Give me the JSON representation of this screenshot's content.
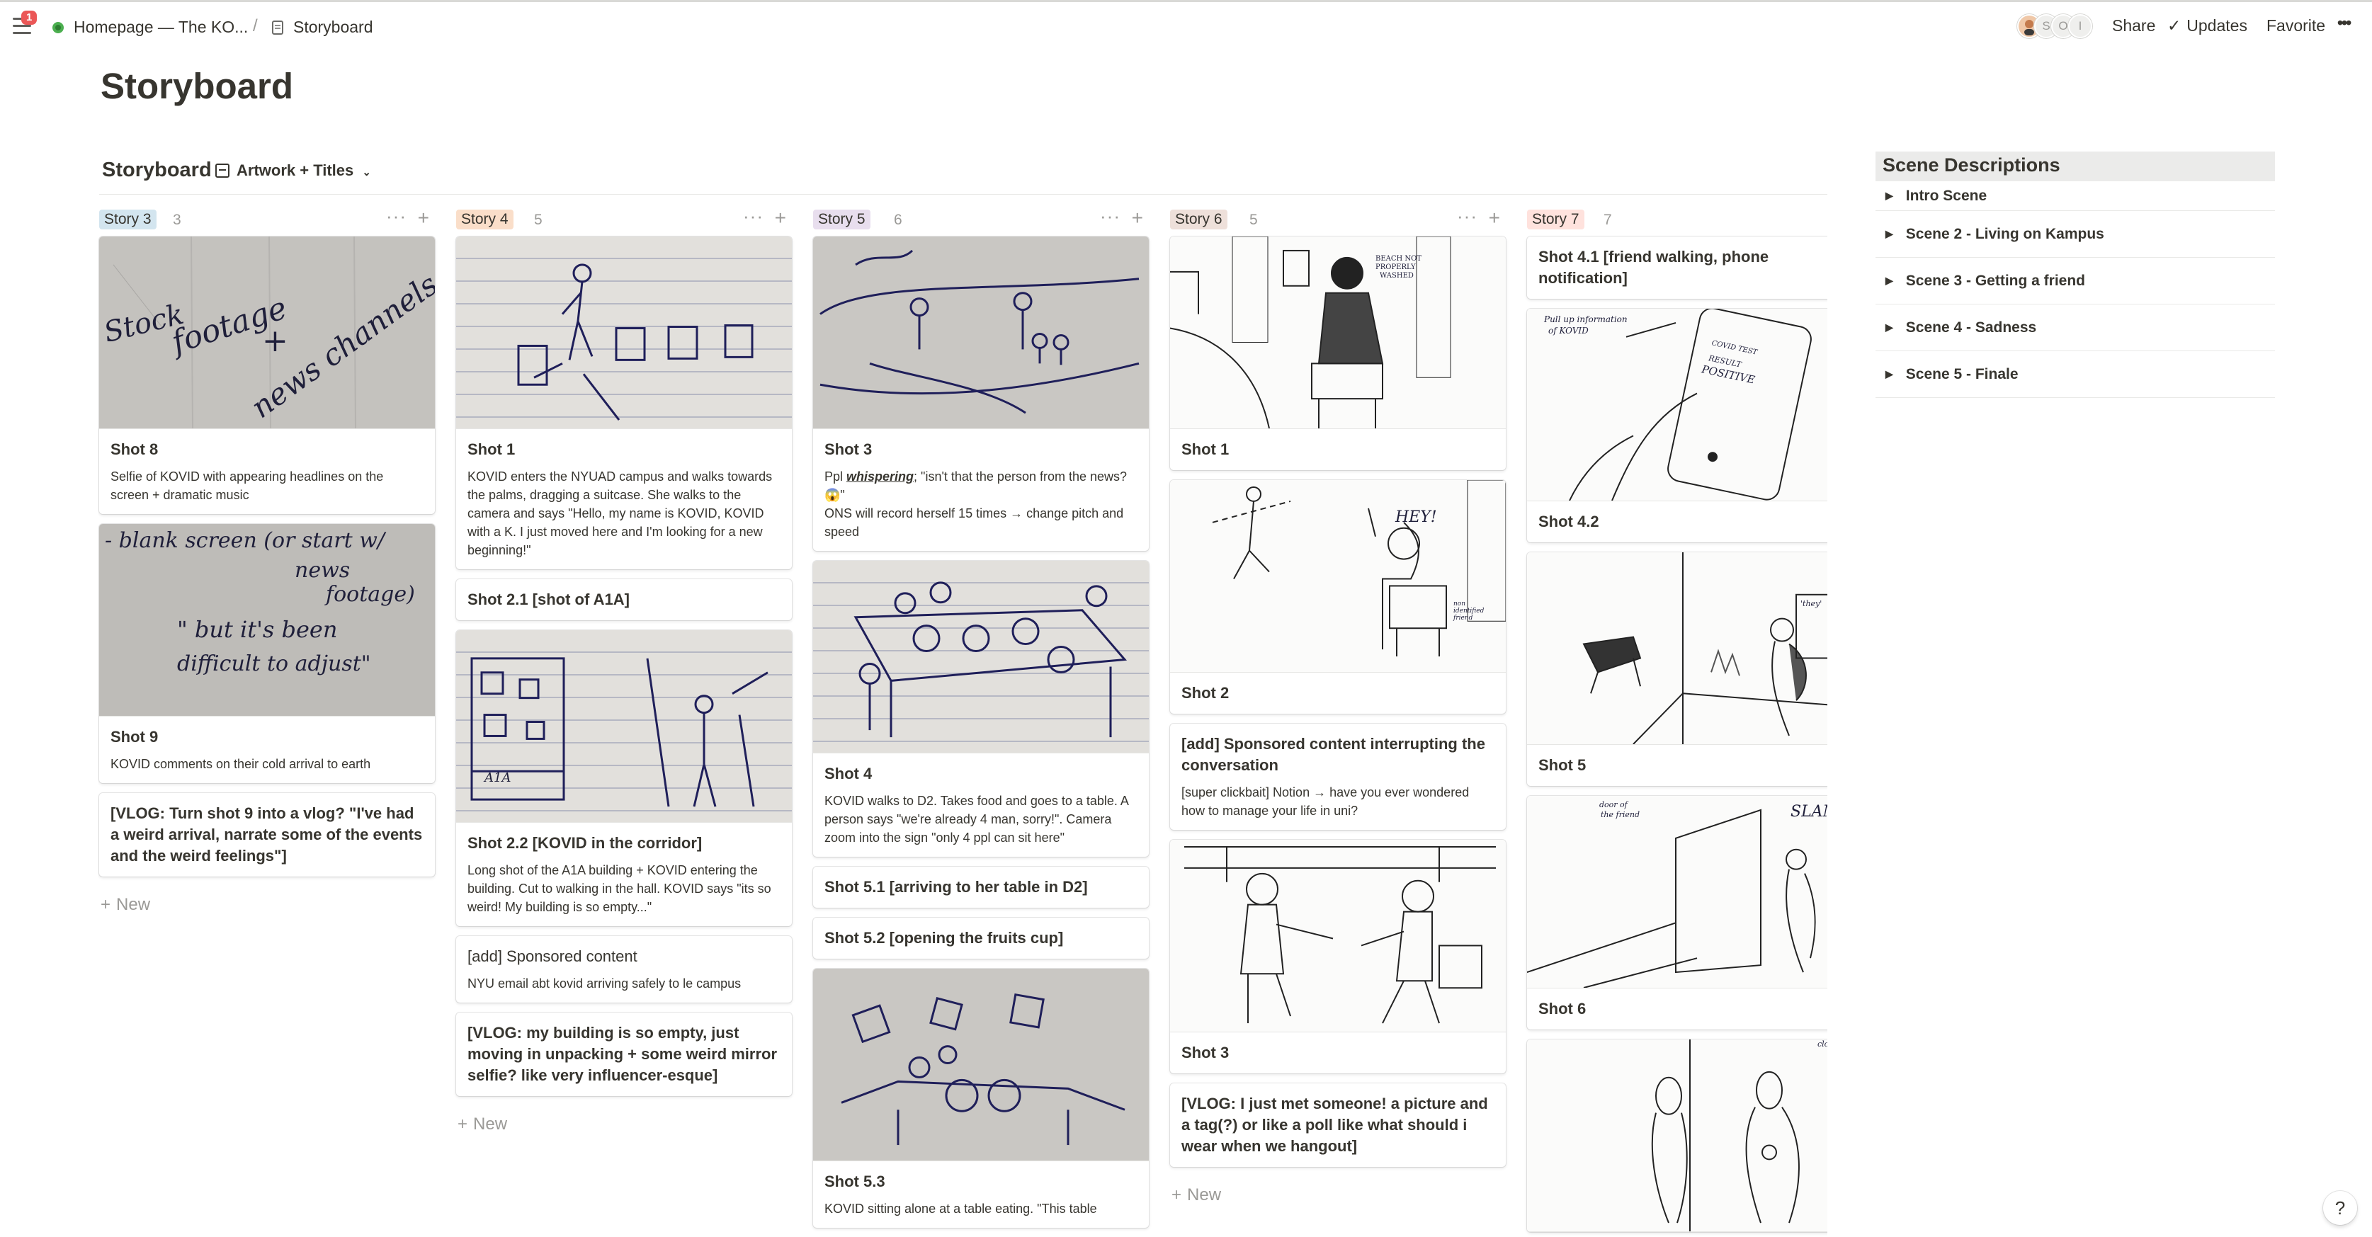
{
  "topbar": {
    "notification_count": "1",
    "breadcrumb": [
      "Homepage — The KO...",
      "/",
      "Storyboard"
    ],
    "share_label": "Share",
    "updates_label": "Updates",
    "favorite_label": "Favorite",
    "more_label": "•••",
    "avatars": [
      "S",
      "O",
      "I"
    ]
  },
  "page": {
    "title": "Storyboard"
  },
  "view": {
    "name": "Storyboard",
    "layout_label": "Artwork + Titles"
  },
  "board": {
    "columns": [
      {
        "label": "Story 3",
        "count": "3",
        "color": "#d3e5ef",
        "cards": [
          {
            "title": "Shot 8",
            "desc": "Selfie of KOVID with appearing headlines on the screen + dramatic music",
            "image_text": [
              "Stock",
              "footage",
              "+",
              "news channels"
            ]
          },
          {
            "title": "Shot 9",
            "desc": "KOVID comments on their cold arrival to earth",
            "image_text": [
              "- blank screen (or start w/",
              "news",
              "footage)",
              "\" but it's been",
              "difficult to adjust\""
            ]
          },
          {
            "title": "[VLOG: Turn shot 9 into a vlog? \"I've had a weird arrival, narrate some of the events and the weird feelings\"]"
          }
        ],
        "new_label": "New"
      },
      {
        "label": "Story 4",
        "count": "5",
        "color": "#fadec9",
        "cards": [
          {
            "title": "Shot 1",
            "desc": "KOVID enters the NYUAD campus and walks towards the palms, dragging a suitcase. She walks to the camera and says \"Hello, my name is KOVID, KOVID with a K. I just moved here and I'm looking for a new beginning!\""
          },
          {
            "title": "Shot 2.1 [shot of A1A]"
          },
          {
            "title": "Shot 2.2 [KOVID in the corridor]",
            "desc": "Long shot of the A1A building + KOVID entering the building. Cut to walking in the hall. KOVID says \"its so weird! My building is so empty...\"",
            "image_text": [
              "A1A"
            ]
          },
          {
            "title": "[add] Sponsored content",
            "desc": "NYU email abt kovid arriving safely to le campus"
          },
          {
            "title": "[VLOG: my building is so empty, just moving in unpacking + some weird mirror selfie? like very influencer-esque]"
          }
        ],
        "new_label": "New"
      },
      {
        "label": "Story 5",
        "count": "6",
        "color": "#e8deee",
        "cards": [
          {
            "title": "Shot 3",
            "desc_prefix": "Ppl ",
            "desc_em": "whispering",
            "desc_rest": "; \"isn't that the person from the news? 😱\"",
            "desc_line2": "ONS will record herself 15 times → change pitch and speed"
          },
          {
            "title": "Shot 4",
            "desc": "KOVID walks to D2. Takes food and goes to a table. A person says \"we're already 4 man, sorry!\". Camera zoom into the sign \"only 4 ppl can sit here\""
          },
          {
            "title": "Shot 5.1 [arriving to her table in D2]"
          },
          {
            "title": "Shot 5.2 [opening the fruits cup]"
          },
          {
            "title": "Shot 5.3",
            "desc": "KOVID sitting alone at a table eating. \"This table"
          }
        ]
      },
      {
        "label": "Story 6",
        "count": "5",
        "color": "#eee0da",
        "cards": [
          {
            "title": "Shot 1",
            "image_text": [
              "BEACH NOT",
              "PROPERLY",
              "WASHED"
            ]
          },
          {
            "title": "Shot 2",
            "image_text": [
              "HEY!",
              "non",
              "identified",
              "friend"
            ]
          },
          {
            "title": "[add] Sponsored content interrupting the conversation",
            "desc": "[super clickbait] Notion → have you ever wondered how to manage your life in uni?"
          },
          {
            "title": "Shot 3"
          },
          {
            "title": "[VLOG: I just met someone! a picture and a tag(?) or like a poll like what should i wear when we hangout]"
          }
        ],
        "new_label": "New"
      },
      {
        "label": "Story 7",
        "count": "7",
        "color": "#ffe2dd",
        "cards": [
          {
            "title": "Shot 4.1 [friend walking, phone notification]"
          },
          {
            "title": "Shot 4.2",
            "image_text": [
              "Pull up information",
              "of KOVID",
              "COVID TEST",
              "RESULT",
              "POSITIVE"
            ]
          },
          {
            "title": "Shot 5",
            "image_text": [
              "'they'"
            ]
          },
          {
            "title": "Shot 6",
            "image_text": [
              "door of",
              "the friend",
              "SLAM"
            ]
          },
          {
            "title": "",
            "image_text": [
              "close the"
            ]
          }
        ]
      }
    ]
  },
  "scenes": {
    "heading": "Scene Descriptions",
    "items": [
      "Intro Scene",
      "Scene 2 - Living on Kampus",
      "Scene 3 - Getting a friend",
      "Scene 4 - Sadness",
      "Scene 5 - Finale"
    ]
  },
  "help_label": "?"
}
